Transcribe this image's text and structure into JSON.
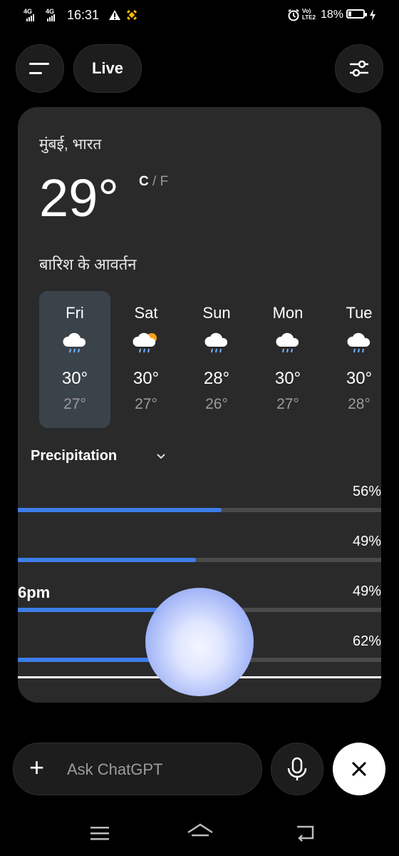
{
  "status": {
    "net1": "4G",
    "net2": "4G",
    "time": "16:31",
    "volte": "Vo)",
    "lte": "LTE2",
    "battery": "18%"
  },
  "top": {
    "live_label": "Live"
  },
  "weather": {
    "location": "मुंबई, भारत",
    "current_temp": "29°",
    "unit_c": "C",
    "unit_sep": "/",
    "unit_f": "F",
    "forecast_title": "बारिश के आवर्तन",
    "days": [
      {
        "name": "Fri",
        "icon": "rain-cloud-icon",
        "high": "30°",
        "low": "27°"
      },
      {
        "name": "Sat",
        "icon": "sun-rain-cloud-icon",
        "high": "30°",
        "low": "27°"
      },
      {
        "name": "Sun",
        "icon": "rain-cloud-icon",
        "high": "28°",
        "low": "26°"
      },
      {
        "name": "Mon",
        "icon": "rain-cloud-icon",
        "high": "30°",
        "low": "27°"
      },
      {
        "name": "Tue",
        "icon": "rain-cloud-icon",
        "high": "30°",
        "low": "28°"
      }
    ],
    "precip_label": "Precipitation",
    "precip_rows": [
      {
        "pct": "56%",
        "value": 0.56
      },
      {
        "pct": "49%",
        "value": 0.49
      },
      {
        "pct": "49%",
        "value": 0.49,
        "time": "6pm"
      },
      {
        "pct": "62%",
        "value": 0.62
      }
    ]
  },
  "composer": {
    "placeholder": "Ask ChatGPT"
  },
  "colors": {
    "accent": "#3d7de8",
    "card": "#2a2a2a",
    "selected_day": "#3b434a"
  }
}
